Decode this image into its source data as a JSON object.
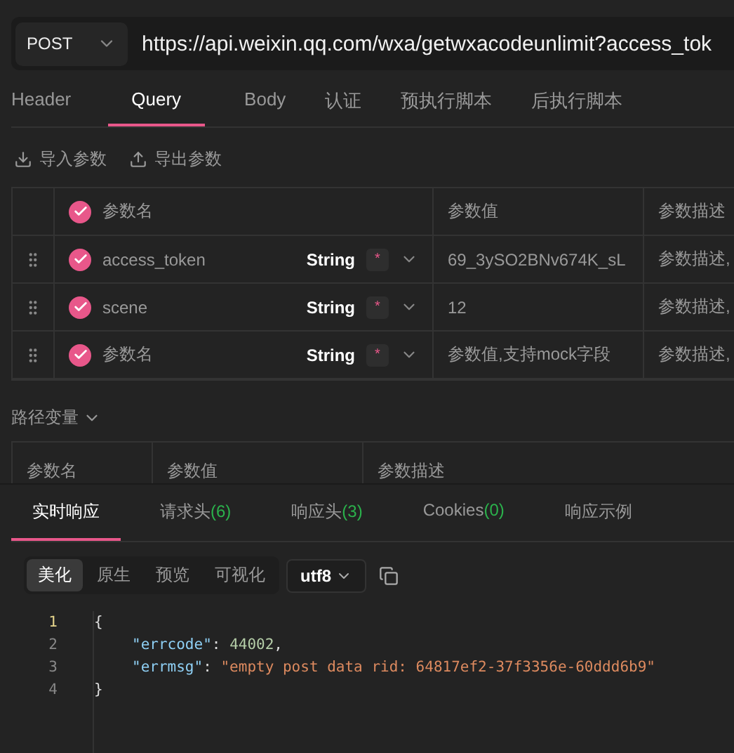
{
  "request": {
    "method": "POST",
    "url": "https://api.weixin.qq.com/wxa/getwxacodeunlimit?access_tok"
  },
  "tabs": [
    {
      "label": "Header",
      "selected": false
    },
    {
      "label": "Query",
      "selected": true
    },
    {
      "label": "Body",
      "selected": false
    },
    {
      "label": "认证",
      "selected": false
    },
    {
      "label": "预执行脚本",
      "selected": false
    },
    {
      "label": "后执行脚本",
      "selected": false
    }
  ],
  "actions": [
    {
      "kind": "import",
      "label": "导入参数"
    },
    {
      "kind": "export",
      "label": "导出参数"
    }
  ],
  "params_table": {
    "all_checked": true,
    "columns": [
      "参数名",
      "参数值",
      "参数描述"
    ],
    "rows": [
      {
        "checked": true,
        "name": "access_token",
        "type": "String",
        "required": "*",
        "value": "69_3ySO2BNv674K_sL",
        "description": "参数描述,"
      },
      {
        "checked": true,
        "name": "scene",
        "type": "String",
        "required": "*",
        "value": "12",
        "description": "参数描述,"
      },
      {
        "checked": true,
        "name": "参数名",
        "type": "String",
        "required": "*",
        "value": "参数值,支持mock字段",
        "description": "参数描述,"
      }
    ]
  },
  "path_variables": {
    "label": "路径变量",
    "expanded": true,
    "columns": [
      "参数名",
      "参数值",
      "参数描述"
    ]
  },
  "response_tabs": [
    {
      "label": "实时响应",
      "selected": true
    },
    {
      "label": "请求头",
      "count": "(6)",
      "selected": false
    },
    {
      "label": "响应头",
      "count": "(3)",
      "selected": false
    },
    {
      "label": "Cookies",
      "count": "(0)",
      "selected": false
    },
    {
      "label": "响应示例",
      "selected": false
    }
  ],
  "view_modes": [
    {
      "label": "美化",
      "selected": true
    },
    {
      "label": "原生",
      "selected": false
    },
    {
      "label": "预览",
      "selected": false
    },
    {
      "label": "可视化",
      "selected": false
    }
  ],
  "encoding": "utf8",
  "code_lines": [
    {
      "number": "1",
      "indented": false,
      "tokens": [
        {
          "kind": "punct",
          "text": "{"
        }
      ]
    },
    {
      "number": "2",
      "indented": true,
      "tokens": [
        {
          "kind": "key",
          "text": "\"errcode\""
        },
        {
          "kind": "punct",
          "text": ": "
        },
        {
          "kind": "number",
          "text": "44002"
        },
        {
          "kind": "punct",
          "text": ","
        }
      ]
    },
    {
      "number": "3",
      "indented": true,
      "tokens": [
        {
          "kind": "key",
          "text": "\"errmsg\""
        },
        {
          "kind": "punct",
          "text": ": "
        },
        {
          "kind": "string",
          "text": "\"empty post data rid: 64817ef2-37f3356e-60ddd6b9\""
        }
      ]
    },
    {
      "number": "4",
      "indented": false,
      "tokens": [
        {
          "kind": "punct",
          "text": "}"
        }
      ]
    }
  ]
}
